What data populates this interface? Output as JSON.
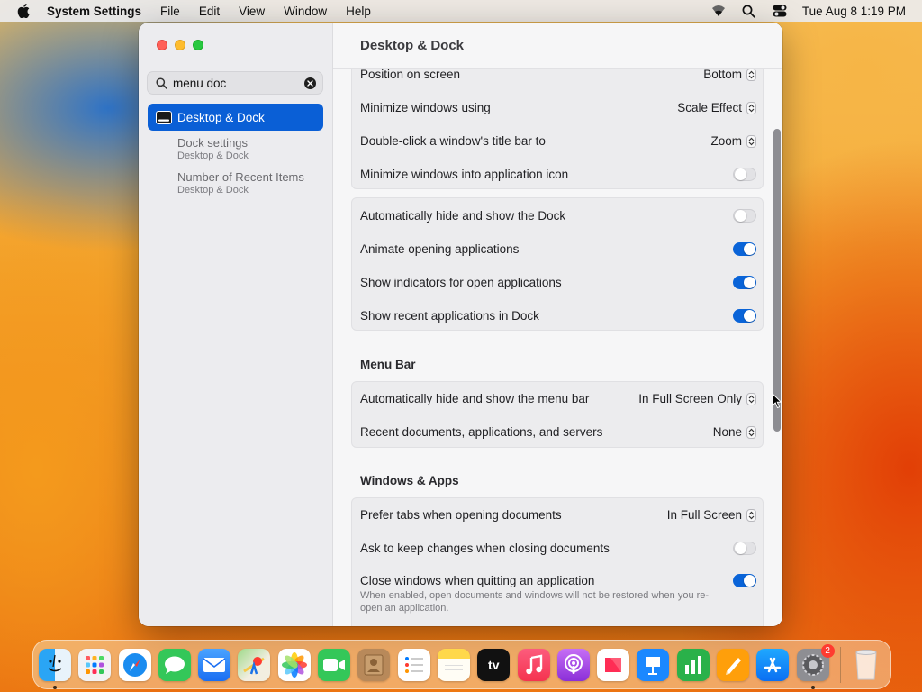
{
  "menubar": {
    "app_name": "System Settings",
    "items": [
      "File",
      "Edit",
      "View",
      "Window",
      "Help"
    ],
    "clock": "Tue Aug 8  1:19 PM"
  },
  "window": {
    "search": {
      "value": "menu doc",
      "placeholder": "Search"
    },
    "sidebar": {
      "selected": "Desktop & Dock",
      "results": [
        {
          "title": "Dock settings",
          "subtitle": "Desktop & Dock"
        },
        {
          "title": "Number of Recent Items",
          "subtitle": "Desktop & Dock"
        }
      ]
    },
    "title": "Desktop & Dock",
    "group1": {
      "position_label": "Position on screen",
      "position_value": "Bottom",
      "minimize_label": "Minimize windows using",
      "minimize_value": "Scale Effect",
      "doubleclick_label": "Double-click a window's title bar to",
      "doubleclick_value": "Zoom",
      "minimize_into_icon_label": "Minimize windows into application icon",
      "minimize_into_icon_on": false
    },
    "group2": {
      "autohide_dock_label": "Automatically hide and show the Dock",
      "autohide_dock_on": false,
      "animate_label": "Animate opening applications",
      "animate_on": true,
      "indicators_label": "Show indicators for open applications",
      "indicators_on": true,
      "recent_apps_label": "Show recent applications in Dock",
      "recent_apps_on": true
    },
    "menu_bar_section": {
      "title": "Menu Bar",
      "autohide_menubar_label": "Automatically hide and show the menu bar",
      "autohide_menubar_value": "In Full Screen Only",
      "recent_docs_label": "Recent documents, applications, and servers",
      "recent_docs_value": "None"
    },
    "windows_apps_section": {
      "title": "Windows & Apps",
      "prefer_tabs_label": "Prefer tabs when opening documents",
      "prefer_tabs_value": "In Full Screen",
      "ask_keep_label": "Ask to keep changes when closing documents",
      "ask_keep_on": false,
      "close_windows_label": "Close windows when quitting an application",
      "close_windows_on": true,
      "close_windows_desc": "When enabled, open documents and windows will not be restored when you re-open an application."
    }
  },
  "dock": {
    "apps": [
      "Finder",
      "Launchpad",
      "Safari",
      "Messages",
      "Mail",
      "Maps",
      "Photos",
      "FaceTime",
      "Contacts",
      "Reminders",
      "Notes",
      "TV",
      "Music",
      "Podcasts",
      "News",
      "Keynote",
      "Numbers",
      "Pages",
      "App Store",
      "System Settings"
    ],
    "tv_label": "tv",
    "settings_badge": "2",
    "trash": "Trash"
  },
  "colors": {
    "accent": "#0a64d8",
    "selection": "#0a5fd6"
  }
}
